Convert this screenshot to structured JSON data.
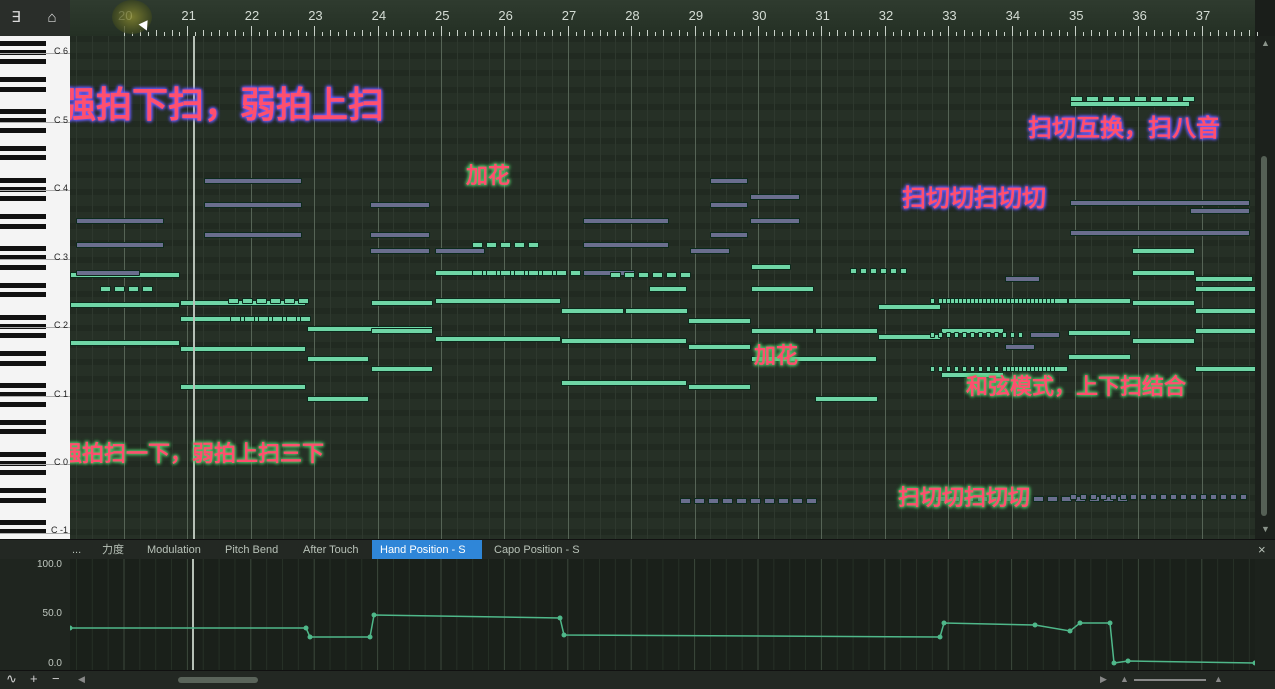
{
  "toolbar": {
    "tool1_icon": "snap-icon",
    "tool2_icon": "drum-icon",
    "tool1_glyph": "∃",
    "tool2_glyph": "⌂"
  },
  "ruler": {
    "bars": [
      "20",
      "21",
      "22",
      "23",
      "24",
      "25",
      "26",
      "27",
      "28",
      "29",
      "30",
      "31",
      "32",
      "33",
      "34",
      "35",
      "36",
      "37"
    ]
  },
  "piano": {
    "octave_labels": [
      "C 6",
      "C 5",
      "C 4",
      "C 3",
      "C 2",
      "C 1",
      "C 0",
      "C -1"
    ]
  },
  "annotations": [
    {
      "text": "强拍下扫，弱拍上扫",
      "style": "blue"
    },
    {
      "text": "加花",
      "style": "green"
    },
    {
      "text": "扫切互换，扫八音",
      "style": "blue"
    },
    {
      "text": "扫切切扫切切",
      "style": "blue"
    },
    {
      "text": "加花",
      "style": "green"
    },
    {
      "text": "和弦模式，上下扫结合",
      "style": "green"
    },
    {
      "text": "强拍扫一下，弱拍上扫三下",
      "style": "green"
    },
    {
      "text": "扫切切扫切切",
      "style": "green"
    }
  ],
  "tabs": {
    "more": "...",
    "items": [
      "力度",
      "Modulation",
      "Pitch Bend",
      "After Touch",
      "Hand Position - S",
      "Capo Position - S"
    ],
    "active": "Hand Position - S"
  },
  "lane": {
    "y_labels": [
      "100.0",
      "50.0",
      "0.0"
    ]
  },
  "colors": {
    "note_green": "#6fd6a6",
    "note_purple": "#6a6e8e",
    "annotation_red": "#ff4f6e",
    "active_tab": "#2f86d8"
  }
}
